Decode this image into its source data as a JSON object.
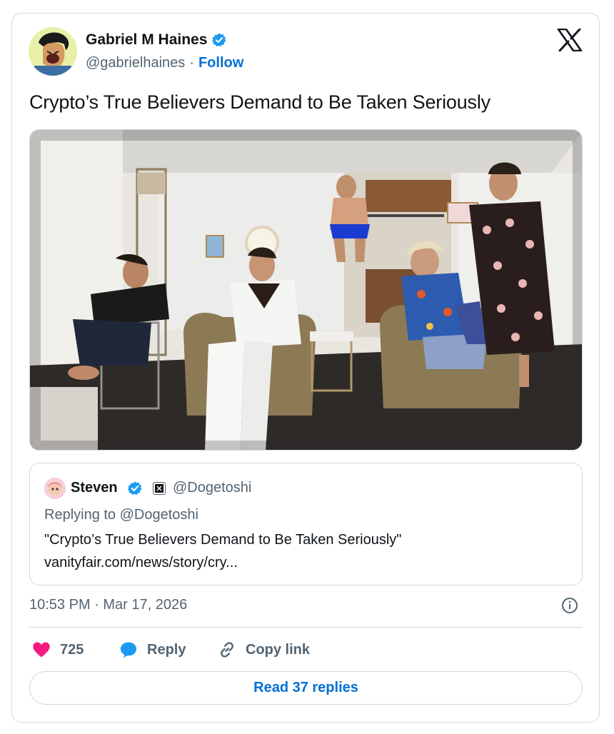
{
  "author": {
    "name": "Gabriel M Haines",
    "handle": "@gabrielhaines",
    "separator": "·",
    "follow_label": "Follow",
    "avatar_icon": "cartoon-avatar",
    "verified_icon": "verified-badge-icon"
  },
  "brand": {
    "logo_icon": "x-logo-icon"
  },
  "tweet": {
    "text": "Crypto’s True Believers Demand to Be Taken Seriously",
    "image_icon": "photo-five-men-in-apartment",
    "timestamp": "10:53 PM · Mar 17, 2026"
  },
  "quote": {
    "name": "Steven",
    "handle": "@Dogetoshi",
    "replying_to": "Replying to @Dogetoshi",
    "text": "\"Crypto’s True Believers Demand to Be Taken Seriously\"",
    "link": "vanityfair.com/news/story/cry..."
  },
  "actions": {
    "like_count": "725",
    "reply_label": "Reply",
    "copy_label": "Copy link",
    "read_replies_label": "Read 37 replies"
  },
  "colors": {
    "accent": "#006fd6",
    "verified": "#1d9bf0",
    "like": "#f91880",
    "muted_text": "#536471",
    "border": "#cfd9de"
  }
}
